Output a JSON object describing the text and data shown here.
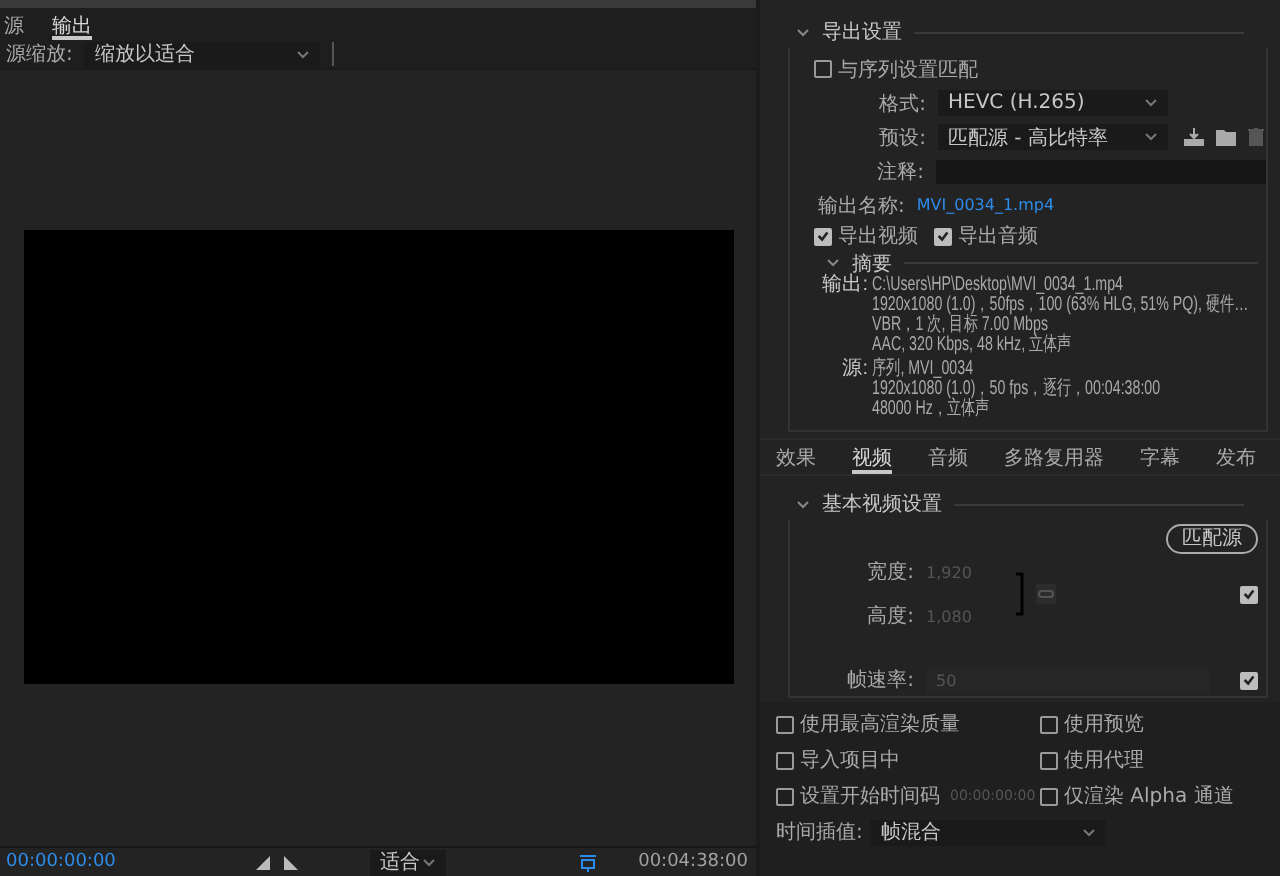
{
  "source_panel": {
    "tabs": [
      {
        "label": "源",
        "selected": false
      },
      {
        "label": "输出",
        "selected": true
      }
    ],
    "scaling": {
      "label": "源缩放:",
      "value": "缩放以适合"
    },
    "timecode_start": "00:00:00:00",
    "zoom": "适合",
    "duration": "00:04:38:00"
  },
  "export_settings": {
    "title": "导出设置",
    "expanded": true,
    "match_sequence": {
      "label": "与序列设置匹配",
      "checked": false
    },
    "format": {
      "label": "格式:",
      "value": "HEVC (H.265)"
    },
    "preset": {
      "label": "预设:",
      "value": "匹配源 - 高比特率"
    },
    "comments": {
      "label": "注释:"
    },
    "output_name": {
      "label": "输出名称:",
      "value": "MVI_0034_1.mp4"
    },
    "exports": [
      {
        "label": "导出视频",
        "checked": true
      },
      {
        "label": "导出音频",
        "checked": true
      }
    ],
    "summary": {
      "title": "摘要",
      "expanded": true,
      "output_label": "输出:",
      "output_lines": [
        "C:\\Users\\HP\\Desktop\\MVI_0034_1.mp4",
        "1920x1080 (1.0)，50fps，100 (63% HLG, 51% PQ), 硬件…",
        "VBR，1 次, 目标 7.00 Mbps",
        "AAC, 320 Kbps, 48  kHz, 立体声"
      ],
      "source_label": "源:",
      "source_lines": [
        "序列, MVI_0034",
        "1920x1080 (1.0)，50 fps，逐行，00:04:38:00",
        "48000 Hz，立体声"
      ]
    }
  },
  "settings_tabs": [
    {
      "label": "效果",
      "selected": false
    },
    {
      "label": "视频",
      "selected": true
    },
    {
      "label": "音频",
      "selected": false
    },
    {
      "label": "多路复用器",
      "selected": false
    },
    {
      "label": "字幕",
      "selected": false
    },
    {
      "label": "发布",
      "selected": false
    }
  ],
  "basic_video": {
    "title": "基本视频设置",
    "expanded": true,
    "match_source": "匹配源",
    "width": {
      "label": "宽度:",
      "value": "1,920"
    },
    "height": {
      "label": "高度:",
      "value": "1,080"
    },
    "size_checked": true,
    "frame_rate": {
      "label": "帧速率:",
      "value": "50",
      "checked": true
    }
  },
  "options": [
    {
      "label": "使用最高渲染质量",
      "checked": false
    },
    {
      "label": "使用预览",
      "checked": false
    },
    {
      "label": "导入项目中",
      "checked": false
    },
    {
      "label": "使用代理",
      "checked": false
    },
    {
      "label": "设置开始时间码",
      "checked": false,
      "value": "00:00:00:00"
    },
    {
      "label": "仅渲染 Alpha 通道",
      "checked": false
    }
  ],
  "time_interpolation": {
    "label": "时间插值:",
    "value": "帧混合"
  }
}
